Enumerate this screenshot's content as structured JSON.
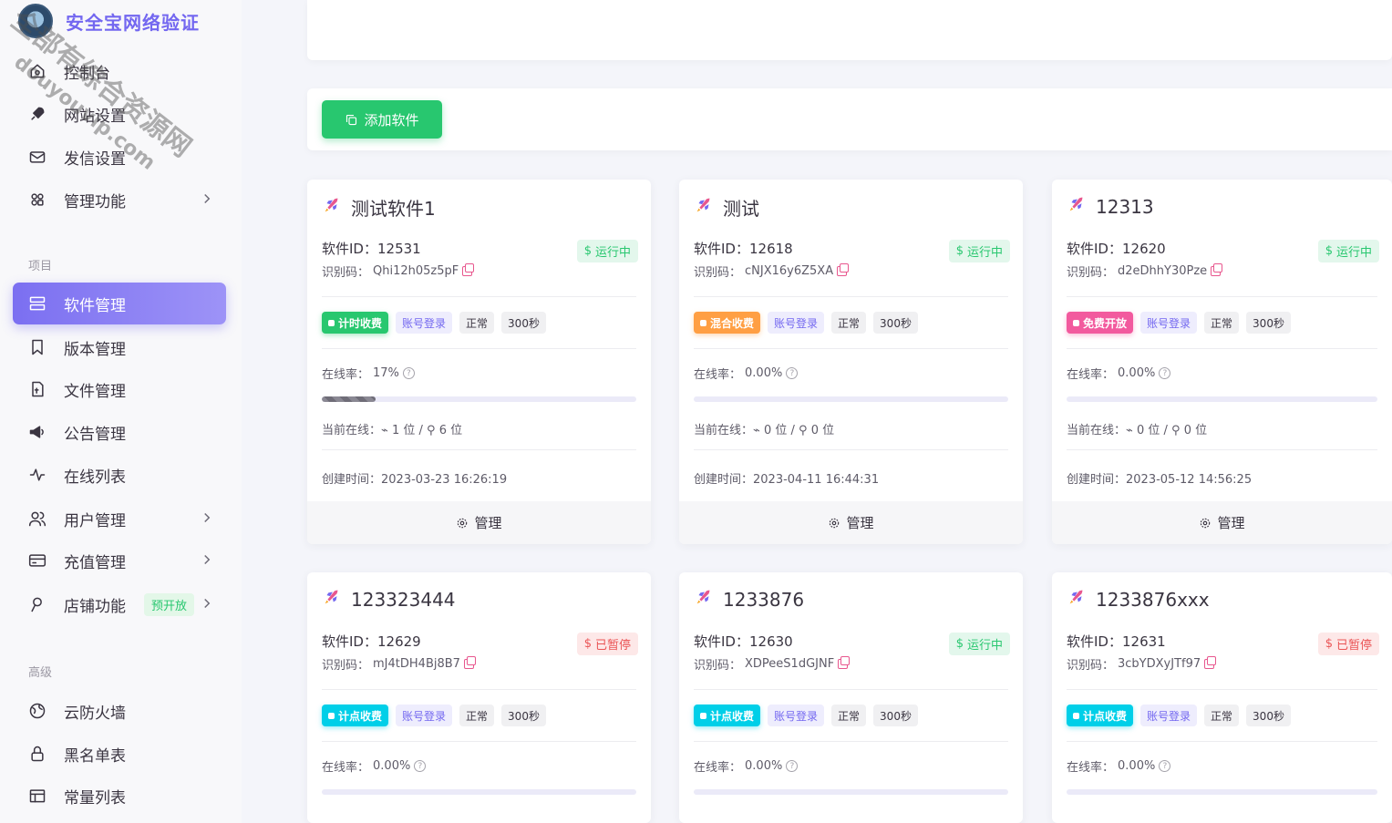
{
  "brand": {
    "name": "安全宝网络验证"
  },
  "watermark": {
    "line1": "全部有综合资源网",
    "line2": "douyouvip.com"
  },
  "sidebar": {
    "items_top": [
      {
        "label": "控制台",
        "icon": "home-icon"
      },
      {
        "label": "网站设置",
        "icon": "rocket-icon"
      },
      {
        "label": "发信设置",
        "icon": "mail-icon"
      },
      {
        "label": "管理功能",
        "icon": "apps-icon",
        "chevron": true
      }
    ],
    "section_project": "项目",
    "items_project": [
      {
        "label": "软件管理",
        "icon": "server-icon",
        "active": true
      },
      {
        "label": "版本管理",
        "icon": "bookmark-icon"
      },
      {
        "label": "文件管理",
        "icon": "file-icon"
      },
      {
        "label": "公告管理",
        "icon": "megaphone-icon"
      },
      {
        "label": "在线列表",
        "icon": "activity-icon"
      },
      {
        "label": "用户管理",
        "icon": "users-icon",
        "chevron": true
      },
      {
        "label": "充值管理",
        "icon": "credit-card-icon",
        "chevron": true
      },
      {
        "label": "店铺功能",
        "icon": "store-icon",
        "chevron": true,
        "badge": "预开放"
      }
    ],
    "section_advanced": "高级",
    "items_advanced": [
      {
        "label": "云防火墙",
        "icon": "globe-icon"
      },
      {
        "label": "黑名单表",
        "icon": "lock-icon"
      },
      {
        "label": "常量列表",
        "icon": "table-icon"
      }
    ]
  },
  "toolbar": {
    "add_label": "添加软件"
  },
  "labels": {
    "sid_prefix": "软件ID：",
    "code_prefix": "识别码：",
    "online_rate_prefix": "在线率：",
    "current_prefix": "当前在线：",
    "created_prefix": "创建时间：",
    "manage": "管理",
    "login_tag": "账号登录",
    "normal_tag": "正常",
    "heartbeat_tag": "300秒"
  },
  "cards": [
    {
      "name": "测试软件1",
      "id": "12531",
      "code": "Qhi12h05z5pF",
      "status": "运行中",
      "status_type": "run",
      "mode": "计时收费",
      "mode_color": "green",
      "online_rate": "17%",
      "online_fraction": 0.17,
      "current": "1 位 / ",
      "current_users": "6 位",
      "created": "2023-03-23 16:26:19"
    },
    {
      "name": "测试",
      "id": "12618",
      "code": "cNJX16y6Z5XA",
      "status": "运行中",
      "status_type": "run",
      "mode": "混合收费",
      "mode_color": "orange",
      "online_rate": "0.00%",
      "online_fraction": 0,
      "current": "0 位 / ",
      "current_users": "0 位",
      "created": "2023-04-11 16:44:31"
    },
    {
      "name": "12313",
      "id": "12620",
      "code": "d2eDhhY30Pze",
      "status": "运行中",
      "status_type": "run",
      "mode": "免费开放",
      "mode_color": "pink",
      "online_rate": "0.00%",
      "online_fraction": 0,
      "current": "0 位 / ",
      "current_users": "0 位",
      "created": "2023-05-12 14:56:25"
    },
    {
      "name": "123323444",
      "id": "12629",
      "code": "mJ4tDH4Bj8B7",
      "status": "已暂停",
      "status_type": "stop",
      "mode": "计点收费",
      "mode_color": "cyan",
      "online_rate": "0.00%",
      "online_fraction": 0
    },
    {
      "name": "1233876",
      "id": "12630",
      "code": "XDPeeS1dGJNF",
      "status": "运行中",
      "status_type": "run",
      "mode": "计点收费",
      "mode_color": "cyan",
      "online_rate": "0.00%",
      "online_fraction": 0
    },
    {
      "name": "1233876xxx",
      "id": "12631",
      "code": "3cbYDXyJTf97",
      "status": "已暂停",
      "status_type": "stop",
      "mode": "计点收费",
      "mode_color": "cyan",
      "online_rate": "0.00%",
      "online_fraction": 0
    }
  ]
}
